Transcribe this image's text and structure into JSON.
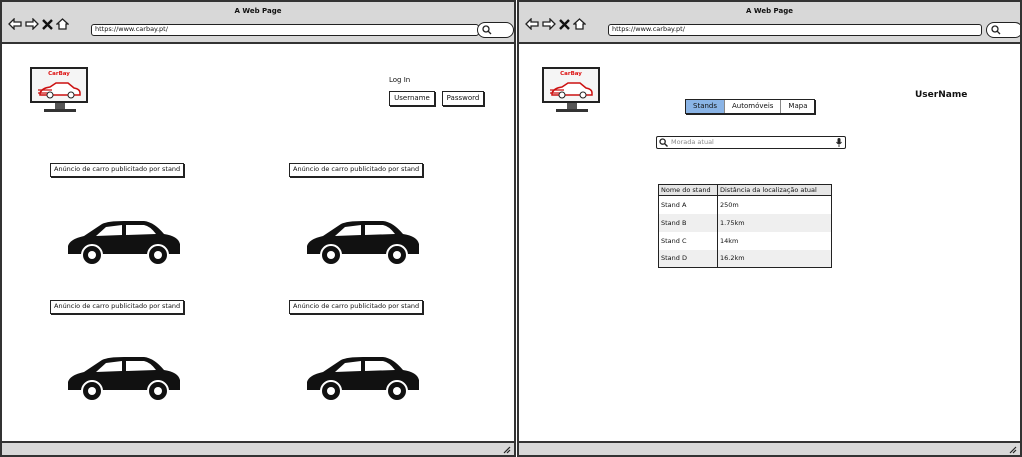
{
  "left_window": {
    "title": "A Web Page",
    "url": "https://www.carbay.pt/",
    "logo_text": "CarBay",
    "login": {
      "heading": "Log In",
      "username_label": "Username",
      "password_label": "Password"
    },
    "ads": [
      {
        "label": "Anúncio de carro publicitado por stand"
      },
      {
        "label": "Anúncio de carro publicitado por stand"
      },
      {
        "label": "Anúncio de carro publicitado por stand"
      },
      {
        "label": "Anúncio de carro publicitado por stand"
      }
    ]
  },
  "right_window": {
    "title": "A Web Page",
    "url": "https://www.carbay.pt/",
    "logo_text": "CarBay",
    "tabs": [
      {
        "label": "Stands",
        "active": true
      },
      {
        "label": "Automóveis",
        "active": false
      },
      {
        "label": "Mapa",
        "active": false
      }
    ],
    "username": "UserName",
    "search": {
      "placeholder": "Morada atual"
    },
    "table": {
      "headers": [
        "Nome do stand",
        "Distância da localização atual"
      ],
      "rows": [
        [
          "Stand A",
          "250m"
        ],
        [
          "Stand B",
          "1.75km"
        ],
        [
          "Stand C",
          "14km"
        ],
        [
          "Stand D",
          "16.2km"
        ]
      ]
    }
  },
  "colors": {
    "chrome": "#d8d8d8",
    "active_tab": "#8ab4e6",
    "brand": "#dd1111"
  }
}
